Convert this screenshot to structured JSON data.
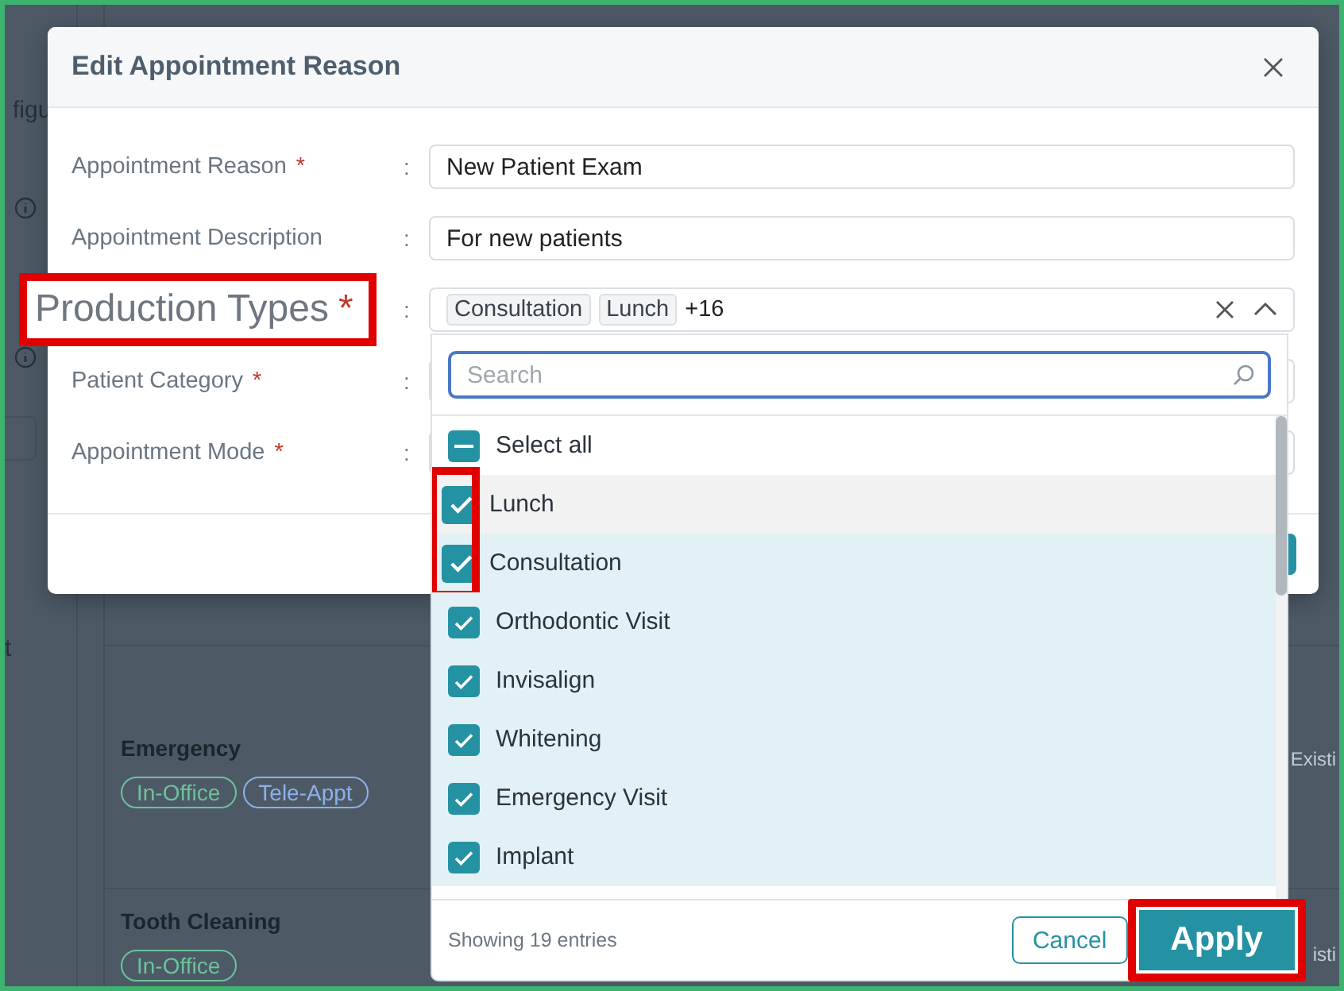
{
  "background": {
    "sidebar_texts": [
      "figu",
      "t"
    ],
    "rows": [
      {
        "title": "Emergency",
        "tags": [
          {
            "label": "In-Office",
            "color": "#6cc39a"
          },
          {
            "label": "Tele-Appt",
            "color": "#8db0ec"
          }
        ],
        "column_2": "Existi"
      },
      {
        "title": "Tooth Cleaning",
        "tags": [
          {
            "label": "In-Office",
            "color": "#6cc39a"
          }
        ],
        "column_2": "isti"
      }
    ]
  },
  "dialog": {
    "title": "Edit Appointment Reason",
    "fields": [
      {
        "kind": "text",
        "label": "Appointment Reason",
        "required_mark": "*",
        "separator": ":",
        "value": "New Patient Exam",
        "highlighted": false
      },
      {
        "kind": "text",
        "label": "Appointment Description",
        "separator": ":",
        "value": "For new patients",
        "highlighted": false
      },
      {
        "kind": "multiselect",
        "label": "Production Types",
        "required_mark": "*",
        "separator": ":",
        "chips": [
          "Consultation",
          "Lunch"
        ],
        "more": "+16",
        "highlighted": true
      },
      {
        "kind": "select",
        "label": "Patient Category",
        "required_mark": "*",
        "separator": ":",
        "highlighted": false
      },
      {
        "kind": "select",
        "label": "Appointment Mode",
        "required_mark": "*",
        "separator": ":",
        "highlighted": false
      }
    ]
  },
  "dropdown": {
    "search": {
      "placeholder": "Search"
    },
    "select_all": {
      "label": "Select all",
      "indeterminate": true
    },
    "options": [
      {
        "label": "Lunch",
        "checked": true,
        "hovered": true,
        "highlighted": true
      },
      {
        "label": "Consultation",
        "checked": true,
        "hovered": false,
        "highlighted": true
      },
      {
        "label": "Orthodontic Visit",
        "checked": true,
        "hovered": false,
        "highlighted": false
      },
      {
        "label": "Invisalign",
        "checked": true,
        "hovered": false,
        "highlighted": false
      },
      {
        "label": "Whitening",
        "checked": true,
        "hovered": false,
        "highlighted": false
      },
      {
        "label": "Emergency Visit",
        "checked": true,
        "hovered": false,
        "highlighted": false
      },
      {
        "label": "Implant",
        "checked": true,
        "hovered": false,
        "highlighted": false
      }
    ],
    "footer_text": "Showing 19 entries",
    "cancel": {
      "label": "Cancel"
    },
    "apply": {
      "label": "Apply",
      "highlighted": true
    }
  }
}
